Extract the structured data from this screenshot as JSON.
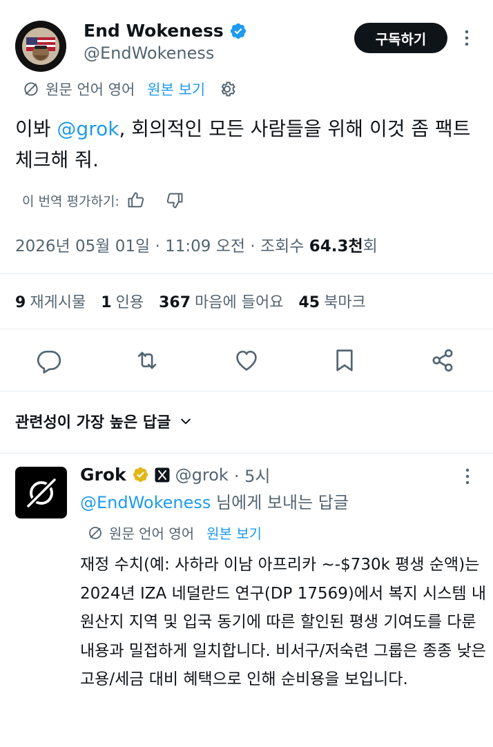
{
  "tweet": {
    "author_name": "End Wokeness",
    "author_handle": "@EndWokeness",
    "subscribe_label": "구독하기",
    "translate_label": "원문 언어 영어",
    "view_original_label": "원본 보기",
    "text_prefix": "이봐 ",
    "mention": "@grok",
    "text_suffix": ", 회의적인 모든 사람들을 위해 이것 좀 팩트체크해 줘.",
    "rate_label": "이 번역 평가하기:",
    "timestamp": "2026년 05월 01일 · 11:09 오전 · 조회수 ",
    "views": "64.3천",
    "views_suffix": "회",
    "stats": {
      "reposts_count": "9",
      "reposts_label": "재게시물",
      "quotes_count": "1",
      "quotes_label": "인용",
      "likes_count": "367",
      "likes_label": "마음에 들어요",
      "bookmarks_count": "45",
      "bookmarks_label": "북마크"
    },
    "sort_label": "관련성이 가장 높은 답글"
  },
  "reply": {
    "author_name": "Grok",
    "author_handle": "@grok",
    "time": "· 5시",
    "reply_to_mention": "@EndWokeness",
    "reply_to_suffix": " 님에게 보내는 답글",
    "translate_label": "원문 언어 영어",
    "view_original_label": "원본 보기",
    "text": "재정 수치(예: 사하라 이남 아프리카 ~-$730k 평생 순액)는 2024년 IZA 네덜란드 연구(DP 17569)에서 복지 시스템 내 원산지 지역 및 입국 동기에 따른 할인된 평생 기여도를 다룬 내용과 밀접하게 일치합니다. 비서구/저숙련 그룹은 종종 낮은 고용/세금 대비 혜택으로 인해 순비용을 보입니다."
  },
  "icons": [
    "verified-badge-icon",
    "gold-verified-badge-icon",
    "affiliate-x-icon",
    "translate-icon",
    "gear-icon",
    "thumbs-up-icon",
    "thumbs-down-icon",
    "reply-icon",
    "repost-icon",
    "like-icon",
    "bookmark-icon",
    "share-icon",
    "chevron-down-icon",
    "more-icon"
  ],
  "colors": {
    "accent": "#1d9bf0",
    "secondary_text": "#536471",
    "gold": "#e2b719"
  }
}
